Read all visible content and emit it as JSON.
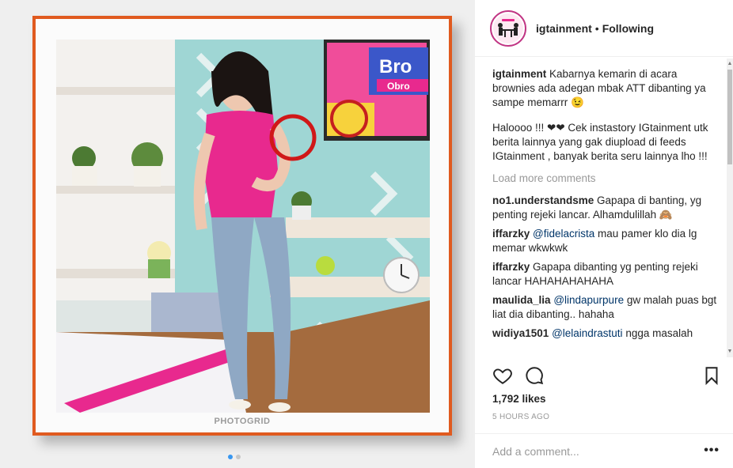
{
  "media": {
    "watermark": "PHOTOGRID",
    "sign_text": "Bro",
    "sign_subtext": "Obro",
    "carousel_dots": 2,
    "active_dot": 0
  },
  "header": {
    "username": "igtainment",
    "separator": "•",
    "follow_status": "Following"
  },
  "caption": {
    "username": "igtainment",
    "text": "Kabarnya kemarin di acara brownies ada adegan mbak ATT dibanting ya sampe memarrr 😉",
    "text2": "Haloooo !!! ❤❤ Cek instastory IGtainment utk berita lainnya yang gak diupload di feeds IGtainment , banyak berita seru lainnya lho !!!"
  },
  "load_more": "Load more comments",
  "comments": [
    {
      "user": "no1.understandsme",
      "mention": "",
      "text": "Gapapa di banting, yg penting rejeki lancar. Alhamdulillah 🙈"
    },
    {
      "user": "iffarzky",
      "mention": "@fidelacrista",
      "text": "mau pamer klo dia lg memar wkwkwk"
    },
    {
      "user": "iffarzky",
      "mention": "",
      "text": "Gapapa dibanting yg penting rejeki lancar HAHAHAHAHAHA"
    },
    {
      "user": "maulida_lia",
      "mention": "@lindapurpure",
      "text": "gw malah puas bgt liat dia dibanting.. hahaha"
    },
    {
      "user": "widiya1501",
      "mention": "@lelaindrastuti",
      "text": "ngga masalah"
    }
  ],
  "actions": {
    "like_icon": "heart-icon",
    "comment_icon": "comment-icon",
    "save_icon": "bookmark-icon"
  },
  "likes": "1,792 likes",
  "timestamp": "5 HOURS AGO",
  "add_comment": {
    "placeholder": "Add a comment...",
    "more": "•••"
  },
  "colors": {
    "frame": "#e05a1f",
    "highlight_circle": "#d01818",
    "top": "#e8298e",
    "accent_link": "#003569",
    "dot_active": "#3897f0"
  }
}
